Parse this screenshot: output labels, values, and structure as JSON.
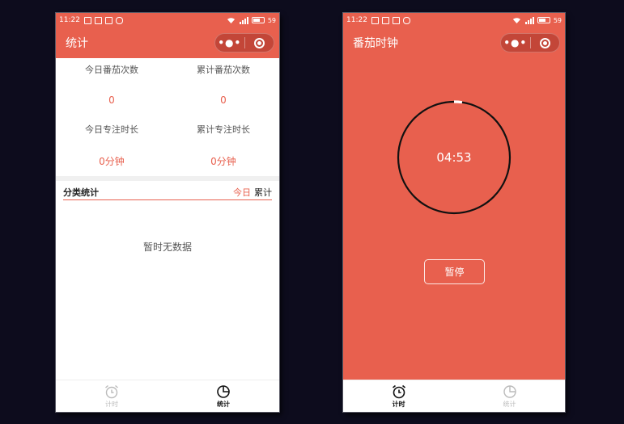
{
  "status_bar": {
    "time": "11:22",
    "battery": "59"
  },
  "stats_screen": {
    "nav_title": "统计",
    "cells": [
      {
        "label": "今日番茄次数",
        "value": "0"
      },
      {
        "label": "累计番茄次数",
        "value": "0"
      },
      {
        "label": "今日专注时长",
        "value": "0分钟"
      },
      {
        "label": "累计专注时长",
        "value": "0分钟"
      }
    ],
    "category": {
      "title": "分类统计",
      "tab_today": "今日",
      "tab_total": "累计"
    },
    "empty_text": "暂时无数据"
  },
  "timer_screen": {
    "nav_title": "番茄时钟",
    "time_display": "04:53",
    "pause_label": "暂停",
    "progress_elapsed": 0.023
  },
  "tabbar": {
    "timer_label": "计时",
    "stats_label": "统计"
  },
  "capsule": {
    "more_glyph": "•●•"
  },
  "colors": {
    "accent": "#e8604e",
    "white": "#ffffff",
    "ring": "#111111"
  }
}
